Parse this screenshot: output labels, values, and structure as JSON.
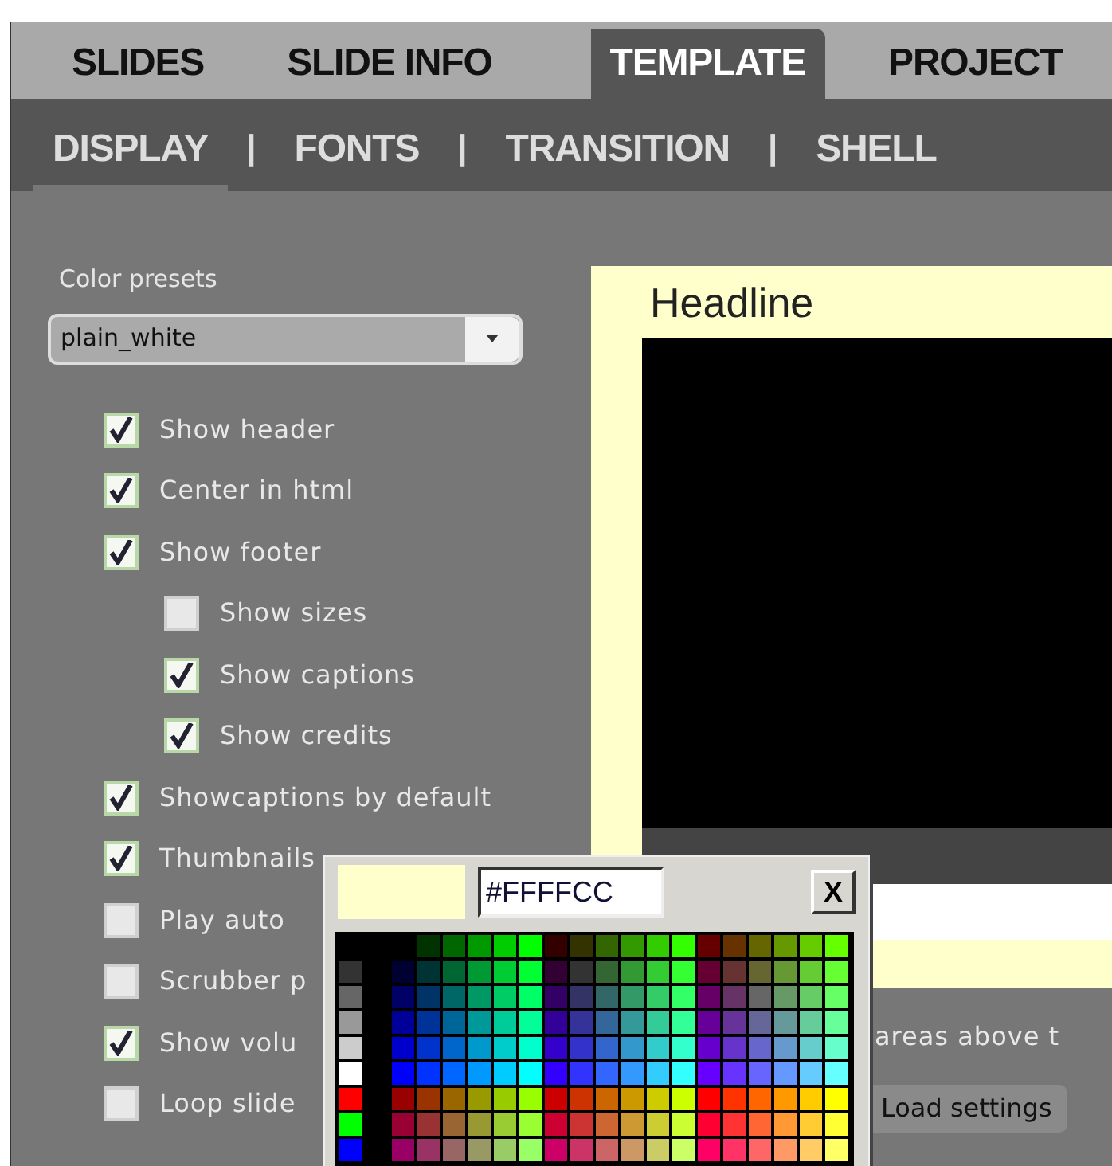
{
  "tabs": [
    {
      "label": "SLIDES",
      "selected": false
    },
    {
      "label": "SLIDE INFO",
      "selected": false
    },
    {
      "label": "TEMPLATE",
      "selected": true
    },
    {
      "label": "PROJECT",
      "selected": false
    }
  ],
  "subtabs": [
    {
      "label": "DISPLAY",
      "selected": true
    },
    {
      "label": "FONTS",
      "selected": false
    },
    {
      "label": "TRANSITION",
      "selected": false
    },
    {
      "label": "SHELL",
      "selected": false
    }
  ],
  "separator": "|",
  "color_presets": {
    "label": "Color presets",
    "value": "plain_white"
  },
  "options": [
    {
      "label": "Show header",
      "checked": true
    },
    {
      "label": "Center in html",
      "checked": true
    },
    {
      "label": "Show footer",
      "checked": true,
      "children": [
        {
          "label": "Show sizes",
          "checked": false
        },
        {
          "label": "Show captions",
          "checked": true
        },
        {
          "label": "Show credits",
          "checked": true
        }
      ]
    },
    {
      "label": "Showcaptions by default",
      "checked": true
    },
    {
      "label": "Thumbnails",
      "checked": true
    },
    {
      "label": "Play auto",
      "checked": false
    },
    {
      "label": "Scrubber p",
      "checked": false
    },
    {
      "label": "Show volu",
      "checked": true
    },
    {
      "label": "Loop slide",
      "checked": false
    }
  ],
  "preview": {
    "headline": "Headline",
    "color": "#ffffcc"
  },
  "hint": "areas above t",
  "load_button": "Load settings",
  "color_picker": {
    "hex": "#FFFFCC",
    "color": "#ffffcc",
    "close": "X"
  }
}
